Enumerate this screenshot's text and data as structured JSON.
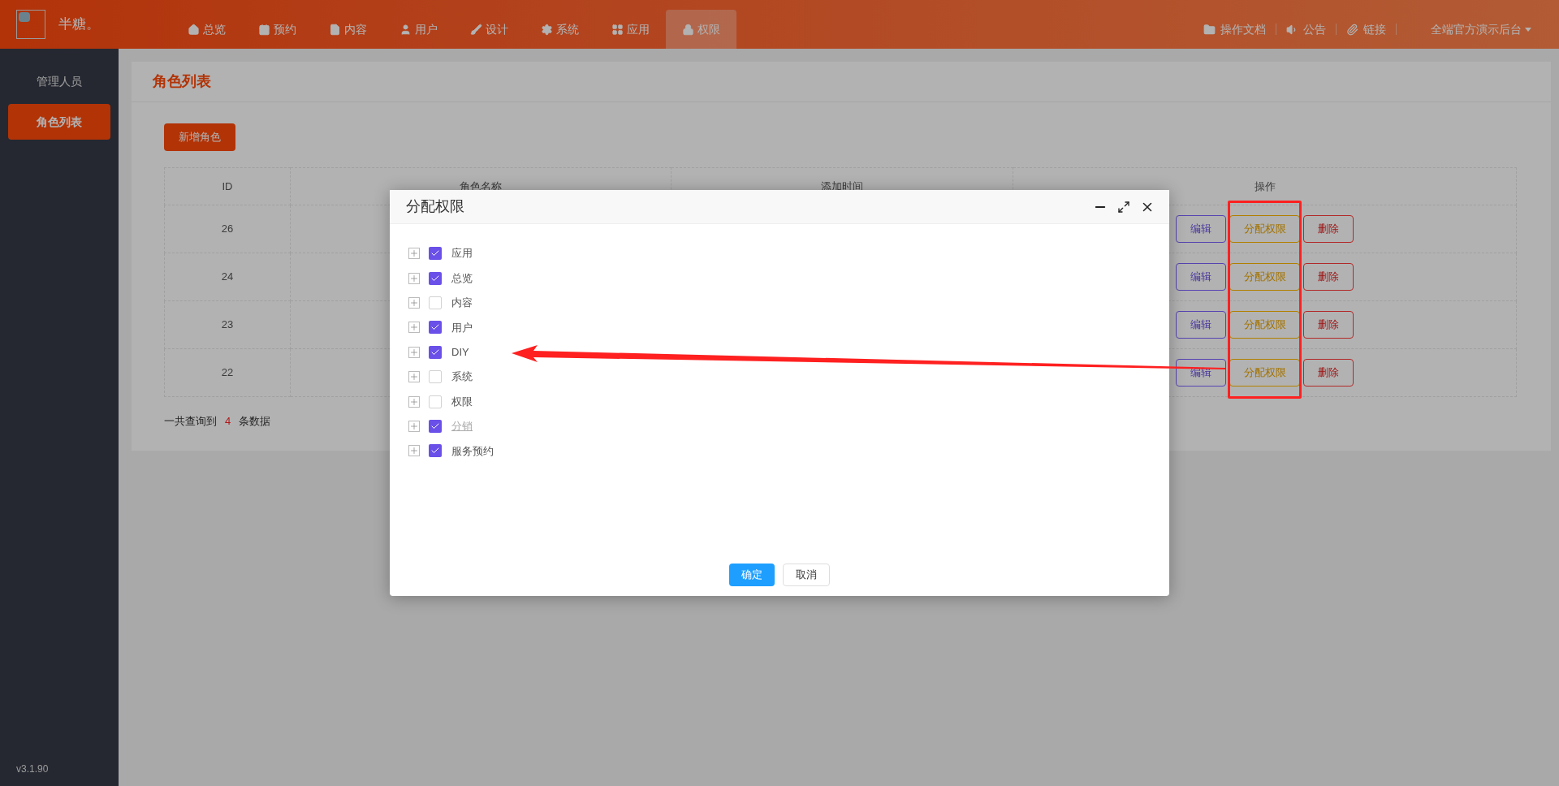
{
  "header": {
    "logo_text": "半糖。",
    "nav": [
      {
        "label": "总览",
        "selected": false
      },
      {
        "label": "预约",
        "selected": false
      },
      {
        "label": "内容",
        "selected": false
      },
      {
        "label": "用户",
        "selected": false
      },
      {
        "label": "设计",
        "selected": false
      },
      {
        "label": "系统",
        "selected": false
      },
      {
        "label": "应用",
        "selected": false
      },
      {
        "label": "权限",
        "selected": true
      }
    ],
    "links": [
      "操作文档",
      "公告",
      "链接"
    ],
    "account": "全端官方演示后台"
  },
  "sidebar": {
    "items": [
      {
        "label": "管理人员",
        "selected": false
      },
      {
        "label": "角色列表",
        "selected": true
      }
    ],
    "version": "v3.1.90"
  },
  "page": {
    "title": "角色列表",
    "add_button": "新增角色",
    "table": {
      "columns": [
        "ID",
        "角色名称",
        "添加时间",
        "操作"
      ],
      "rows": [
        {
          "id": "26",
          "actions": [
            "编辑",
            "分配权限",
            "删除"
          ]
        },
        {
          "id": "24",
          "actions": [
            "编辑",
            "分配权限",
            "删除"
          ]
        },
        {
          "id": "23",
          "actions": [
            "编辑",
            "分配权限",
            "删除"
          ]
        },
        {
          "id": "22",
          "actions": [
            "编辑",
            "分配权限",
            "删除"
          ]
        }
      ]
    },
    "summary": {
      "prefix": "一共查询到",
      "count": "4",
      "suffix": "条数据"
    }
  },
  "dialog": {
    "title": "分配权限",
    "items": [
      {
        "label": "应用",
        "checked": true,
        "disabled": false
      },
      {
        "label": "总览",
        "checked": true,
        "disabled": false
      },
      {
        "label": "内容",
        "checked": false,
        "disabled": false
      },
      {
        "label": "用户",
        "checked": true,
        "disabled": false
      },
      {
        "label": "DIY",
        "checked": true,
        "disabled": false
      },
      {
        "label": "系统",
        "checked": false,
        "disabled": false
      },
      {
        "label": "权限",
        "checked": false,
        "disabled": false
      },
      {
        "label": "分销",
        "checked": true,
        "disabled": true
      },
      {
        "label": "服务预约",
        "checked": true,
        "disabled": false
      }
    ],
    "buttons": [
      {
        "label": "确定",
        "kind": "primary"
      },
      {
        "label": "取消",
        "kind": "default"
      }
    ]
  },
  "annotations": {
    "frame": true,
    "arrow": true
  }
}
